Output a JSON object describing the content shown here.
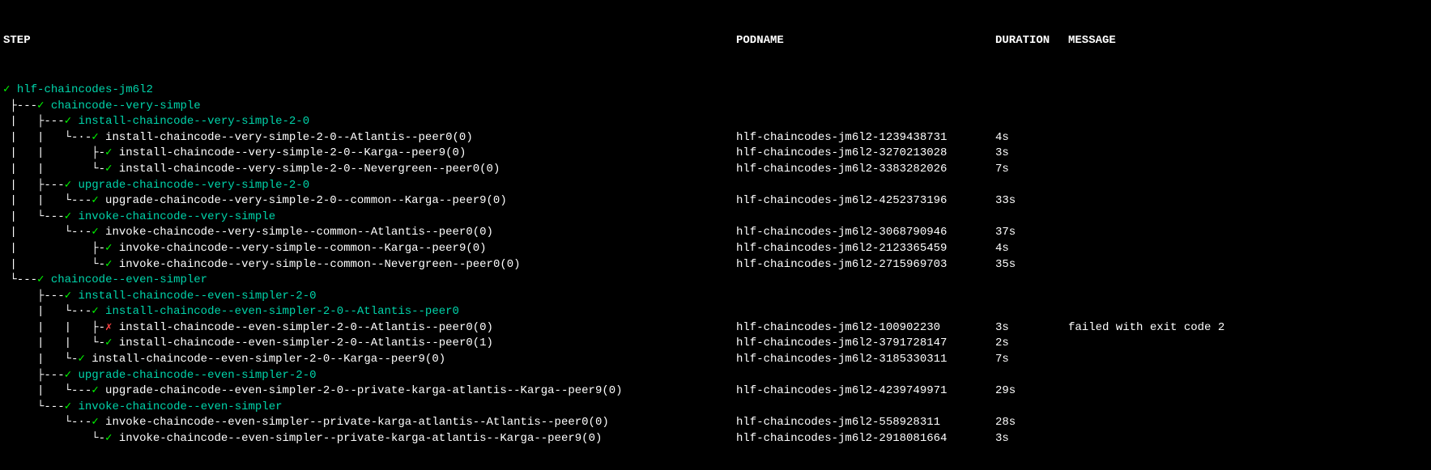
{
  "headers": {
    "step": "STEP",
    "podname": "PODNAME",
    "duration": "DURATION",
    "message": "MESSAGE"
  },
  "rows": [
    {
      "prefix": "",
      "status": "✓",
      "statusColor": "green",
      "label": " hlf-chaincodes-jm6l2",
      "labelColor": "teal",
      "podname": "",
      "duration": "",
      "message": ""
    },
    {
      "prefix": " ├---",
      "status": "✓",
      "statusColor": "green",
      "label": " chaincode--very-simple",
      "labelColor": "teal",
      "podname": "",
      "duration": "",
      "message": ""
    },
    {
      "prefix": " |   ├---",
      "status": "✓",
      "statusColor": "green",
      "label": " install-chaincode--very-simple-2-0",
      "labelColor": "teal",
      "podname": "",
      "duration": "",
      "message": ""
    },
    {
      "prefix": " |   |   └-·-",
      "status": "✓",
      "statusColor": "green",
      "label": " install-chaincode--very-simple-2-0--Atlantis--peer0(0)",
      "labelColor": "white",
      "podname": "hlf-chaincodes-jm6l2-1239438731",
      "duration": "4s",
      "message": ""
    },
    {
      "prefix": " |   |       ├-",
      "status": "✓",
      "statusColor": "green",
      "label": " install-chaincode--very-simple-2-0--Karga--peer9(0)",
      "labelColor": "white",
      "podname": "hlf-chaincodes-jm6l2-3270213028",
      "duration": "3s",
      "message": ""
    },
    {
      "prefix": " |   |       └-",
      "status": "✓",
      "statusColor": "green",
      "label": " install-chaincode--very-simple-2-0--Nevergreen--peer0(0)",
      "labelColor": "white",
      "podname": "hlf-chaincodes-jm6l2-3383282026",
      "duration": "7s",
      "message": ""
    },
    {
      "prefix": " |   ├---",
      "status": "✓",
      "statusColor": "green",
      "label": " upgrade-chaincode--very-simple-2-0",
      "labelColor": "teal",
      "podname": "",
      "duration": "",
      "message": ""
    },
    {
      "prefix": " |   |   └---",
      "status": "✓",
      "statusColor": "green",
      "label": " upgrade-chaincode--very-simple-2-0--common--Karga--peer9(0)",
      "labelColor": "white",
      "podname": "hlf-chaincodes-jm6l2-4252373196",
      "duration": "33s",
      "message": ""
    },
    {
      "prefix": " |   └---",
      "status": "✓",
      "statusColor": "green",
      "label": " invoke-chaincode--very-simple",
      "labelColor": "teal",
      "podname": "",
      "duration": "",
      "message": ""
    },
    {
      "prefix": " |       └-·-",
      "status": "✓",
      "statusColor": "green",
      "label": " invoke-chaincode--very-simple--common--Atlantis--peer0(0)",
      "labelColor": "white",
      "podname": "hlf-chaincodes-jm6l2-3068790946",
      "duration": "37s",
      "message": ""
    },
    {
      "prefix": " |           ├-",
      "status": "✓",
      "statusColor": "green",
      "label": " invoke-chaincode--very-simple--common--Karga--peer9(0)",
      "labelColor": "white",
      "podname": "hlf-chaincodes-jm6l2-2123365459",
      "duration": "4s",
      "message": ""
    },
    {
      "prefix": " |           └-",
      "status": "✓",
      "statusColor": "green",
      "label": " invoke-chaincode--very-simple--common--Nevergreen--peer0(0)",
      "labelColor": "white",
      "podname": "hlf-chaincodes-jm6l2-2715969703",
      "duration": "35s",
      "message": ""
    },
    {
      "prefix": " └---",
      "status": "✓",
      "statusColor": "green",
      "label": " chaincode--even-simpler",
      "labelColor": "teal",
      "podname": "",
      "duration": "",
      "message": ""
    },
    {
      "prefix": "     ├---",
      "status": "✓",
      "statusColor": "green",
      "label": " install-chaincode--even-simpler-2-0",
      "labelColor": "teal",
      "podname": "",
      "duration": "",
      "message": ""
    },
    {
      "prefix": "     |   └-·-",
      "status": "✓",
      "statusColor": "green",
      "label": " install-chaincode--even-simpler-2-0--Atlantis--peer0",
      "labelColor": "teal",
      "podname": "",
      "duration": "",
      "message": ""
    },
    {
      "prefix": "     |   |   ├-",
      "status": "✗",
      "statusColor": "red",
      "label": " install-chaincode--even-simpler-2-0--Atlantis--peer0(0)",
      "labelColor": "white",
      "podname": "hlf-chaincodes-jm6l2-100902230",
      "duration": "3s",
      "message": "failed with exit code 2"
    },
    {
      "prefix": "     |   |   └-",
      "status": "✓",
      "statusColor": "green",
      "label": " install-chaincode--even-simpler-2-0--Atlantis--peer0(1)",
      "labelColor": "white",
      "podname": "hlf-chaincodes-jm6l2-3791728147",
      "duration": "2s",
      "message": ""
    },
    {
      "prefix": "     |   └-",
      "status": "✓",
      "statusColor": "green",
      "label": " install-chaincode--even-simpler-2-0--Karga--peer9(0)",
      "labelColor": "white",
      "podname": "hlf-chaincodes-jm6l2-3185330311",
      "duration": "7s",
      "message": ""
    },
    {
      "prefix": "     ├---",
      "status": "✓",
      "statusColor": "green",
      "label": " upgrade-chaincode--even-simpler-2-0",
      "labelColor": "teal",
      "podname": "",
      "duration": "",
      "message": ""
    },
    {
      "prefix": "     |   └---",
      "status": "✓",
      "statusColor": "green",
      "label": " upgrade-chaincode--even-simpler-2-0--private-karga-atlantis--Karga--peer9(0)",
      "labelColor": "white",
      "podname": "hlf-chaincodes-jm6l2-4239749971",
      "duration": "29s",
      "message": ""
    },
    {
      "prefix": "     └---",
      "status": "✓",
      "statusColor": "green",
      "label": " invoke-chaincode--even-simpler",
      "labelColor": "teal",
      "podname": "",
      "duration": "",
      "message": ""
    },
    {
      "prefix": "         └-·-",
      "status": "✓",
      "statusColor": "green",
      "label": " invoke-chaincode--even-simpler--private-karga-atlantis--Atlantis--peer0(0)",
      "labelColor": "white",
      "podname": "hlf-chaincodes-jm6l2-558928311",
      "duration": "28s",
      "message": ""
    },
    {
      "prefix": "             └-",
      "status": "✓",
      "statusColor": "green",
      "label": " invoke-chaincode--even-simpler--private-karga-atlantis--Karga--peer9(0)",
      "labelColor": "white",
      "podname": "hlf-chaincodes-jm6l2-2918081664",
      "duration": "3s",
      "message": ""
    }
  ]
}
